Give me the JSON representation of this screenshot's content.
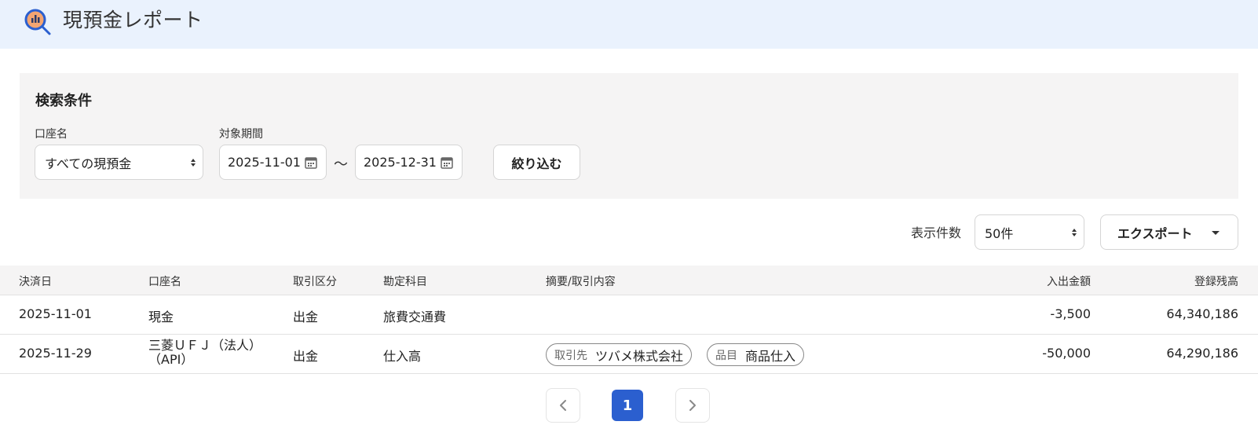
{
  "header": {
    "title": "現預金レポート",
    "logo_icon": "report-search-icon",
    "accent": "#f4a571"
  },
  "search": {
    "title": "検索条件",
    "account_label": "口座名",
    "account_value": "すべての現預金",
    "period_label": "対象期間",
    "date_from": "2025-11-01",
    "date_to": "2025-12-31",
    "tilde": "〜",
    "filter_button": "絞り込む"
  },
  "toolbar": {
    "page_size_label": "表示件数",
    "page_size_value": "50件",
    "export_button": "エクスポート"
  },
  "table": {
    "columns": [
      "決済日",
      "口座名",
      "取引区分",
      "勘定科目",
      "摘要/取引内容",
      "入出金額",
      "登録残高"
    ],
    "rows": [
      {
        "date": "2025-11-01",
        "account": "現金",
        "account_line2": "",
        "type": "出金",
        "subject": "旅費交通費",
        "tags": [],
        "amount": "-3,500",
        "balance": "64,340,186"
      },
      {
        "date": "2025-11-29",
        "account": "三菱ＵＦＪ（法人）",
        "account_line2": "（API）",
        "type": "出金",
        "subject": "仕入高",
        "tags": [
          {
            "key": "取引先",
            "value": "ツバメ株式会社"
          },
          {
            "key": "品目",
            "value": "商品仕入"
          }
        ],
        "amount": "-50,000",
        "balance": "64,290,186"
      }
    ]
  },
  "pagination": {
    "current": "1",
    "prev_icon": "chevron-left-icon",
    "next_icon": "chevron-right-icon",
    "active_color": "#2b5fcf"
  }
}
